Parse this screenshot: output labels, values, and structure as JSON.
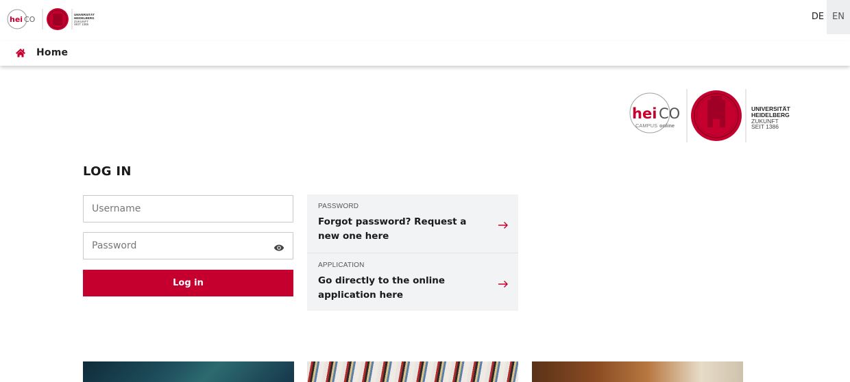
{
  "header": {
    "logo": {
      "brand_hei": "hei",
      "brand_co": "CO",
      "brand_sub_a": "CAMPUS",
      "brand_sub_b": "online",
      "uni_line1": "UNIVERSITÄT",
      "uni_line2": "HEIDELBERG",
      "uni_line3": "ZUKUNFT",
      "uni_line4": "SEIT 1386"
    },
    "languages": [
      "DE",
      "EN"
    ],
    "active_language": "EN"
  },
  "nav": {
    "home_label": "Home",
    "icon": "home-icon"
  },
  "login": {
    "title": "LOG IN",
    "username_placeholder": "Username",
    "password_placeholder": "Password",
    "submit_label": "Log in",
    "eye_icon": "eye-icon"
  },
  "cards": [
    {
      "kicker": "PASSWORD",
      "title": "Forgot password? Request a new one here",
      "icon": "arrow-right-icon"
    },
    {
      "kicker": "APPLICATION",
      "title": "Go directly to the online application here",
      "icon": "arrow-right-icon"
    }
  ],
  "colors": {
    "brand_red": "#c5002f",
    "card_bg": "#f1f3f4",
    "lang_active_bg": "#eceeef"
  }
}
